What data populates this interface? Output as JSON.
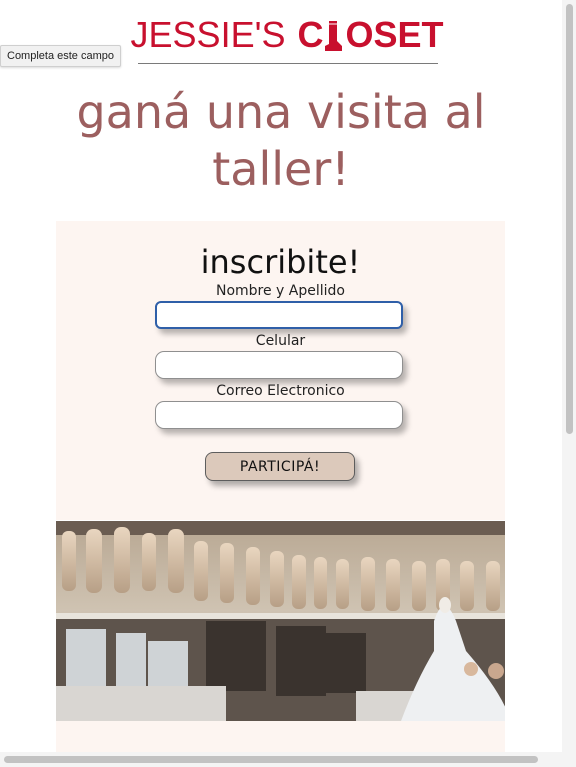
{
  "logo": {
    "left_text": "JESSIE'S",
    "right_prefix": "C",
    "right_suffix": "OSET",
    "brand_color": "#c8102e"
  },
  "tooltip": {
    "text": "Completa este campo"
  },
  "headline": {
    "text": "ganá una visita al taller!",
    "color": "#9c5f5f"
  },
  "form": {
    "title": "inscribite!",
    "fields": [
      {
        "label": "Nombre y Apellido",
        "value": "",
        "focused": true
      },
      {
        "label": "Celular",
        "value": ""
      },
      {
        "label": "Correo Electronico",
        "value": ""
      }
    ],
    "submit_label": "PARTICIPÁ!",
    "background": "#fdf5f1"
  },
  "photo": {
    "icon": "atelier-mannequins-photo"
  }
}
